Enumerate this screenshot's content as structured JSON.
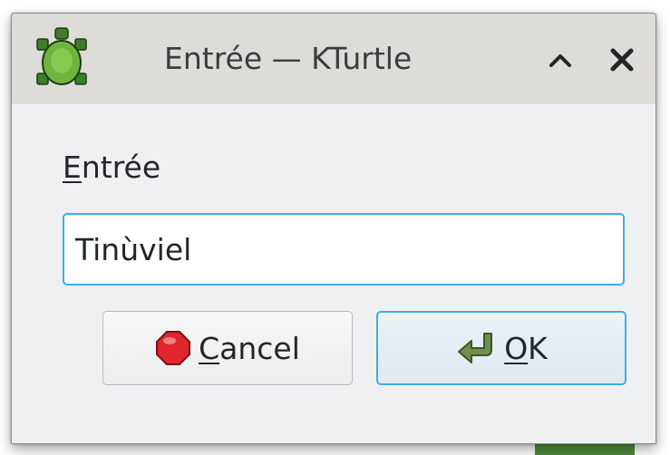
{
  "window": {
    "title": "Entrée — KTurtle",
    "app_icon": "turtle-icon",
    "minimize_icon": "chevron-up-icon",
    "close_icon": "close-icon"
  },
  "form": {
    "label_mnemonic": "E",
    "label_rest": "ntrée",
    "input_value": "Tinùviel"
  },
  "buttons": {
    "cancel": {
      "mnemonic": "C",
      "rest": "ancel",
      "icon": "stop-icon"
    },
    "ok": {
      "mnemonic": "O",
      "rest": "K",
      "icon": "return-arrow-icon"
    }
  },
  "colors": {
    "accent": "#3daee9",
    "titlebar": "#dedcd8",
    "window_bg": "#eff0f1",
    "stop_red": "#e0262c",
    "ok_arrow": "#6f8f4f",
    "turtle_green": "#5a9a3c"
  }
}
